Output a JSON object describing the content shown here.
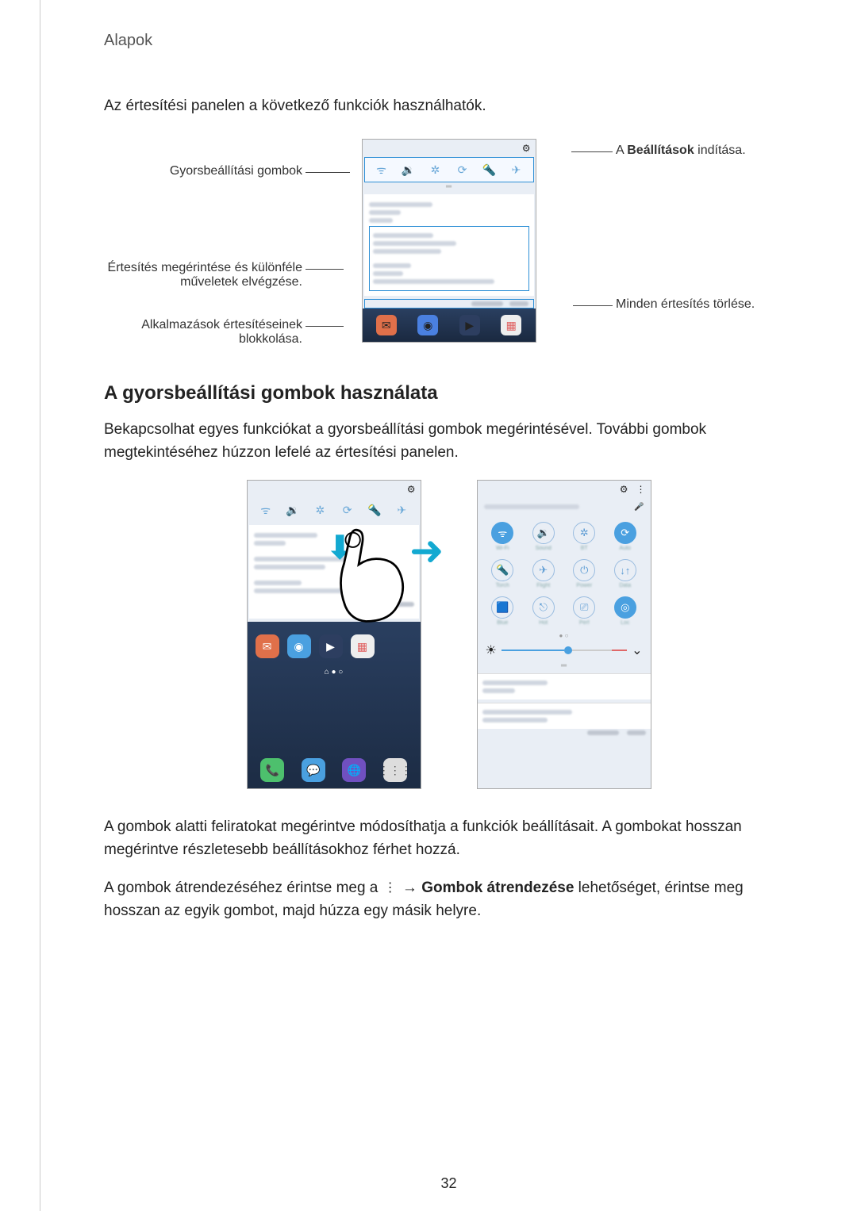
{
  "header": {
    "title": "Alapok"
  },
  "intro": "Az értesítési panelen a következő funkciók használhatók.",
  "fig1": {
    "callouts": {
      "quick_buttons": "Gyorsbeállítási gombok",
      "launch_settings_pre": "A ",
      "launch_settings_bold": "Beállítások",
      "launch_settings_post": " indítása.",
      "tap_notification": "Értesítés megérintése és különféle műveletek elvégzése.",
      "block_app": "Alkalmazások értesítéseinek blokkolása.",
      "clear_all": "Minden értesítés törlése."
    }
  },
  "section2": {
    "heading": "A gyorsbeállítási gombok használata",
    "para1": "Bekapcsolhat egyes funkciókat a gyorsbeállítási gombok megérintésével. További gombok megtekintéséhez húzzon lefelé az értesítési panelen.",
    "para2a": "A gombok alatti feliratokat megérintve módosíthatja a funkciók beállításait. A gombokat hosszan megérintve részletesebb beállításokhoz férhet hozzá.",
    "para2b_pre": "A gombok átrendezéséhez érintse meg a ",
    "para2b_arrow": " → ",
    "para2b_bold": "Gombok átrendezése",
    "para2b_post": " lehetőséget, érintse meg hosszan az egyik gombot, majd húzza egy másik helyre."
  },
  "page_number": "32",
  "icons": {
    "gear": "⚙",
    "more": "⋮",
    "mic": "🎤",
    "wifi": "ᯤ",
    "sound": "🔉",
    "bluetooth": "✲",
    "rotate": "⟳",
    "flashlight": "🔦",
    "airplane": "✈",
    "power": "⏻",
    "data": "↓↑",
    "blue": "🟦",
    "location": "◎",
    "chevron": "⌄",
    "sun": "☀"
  }
}
